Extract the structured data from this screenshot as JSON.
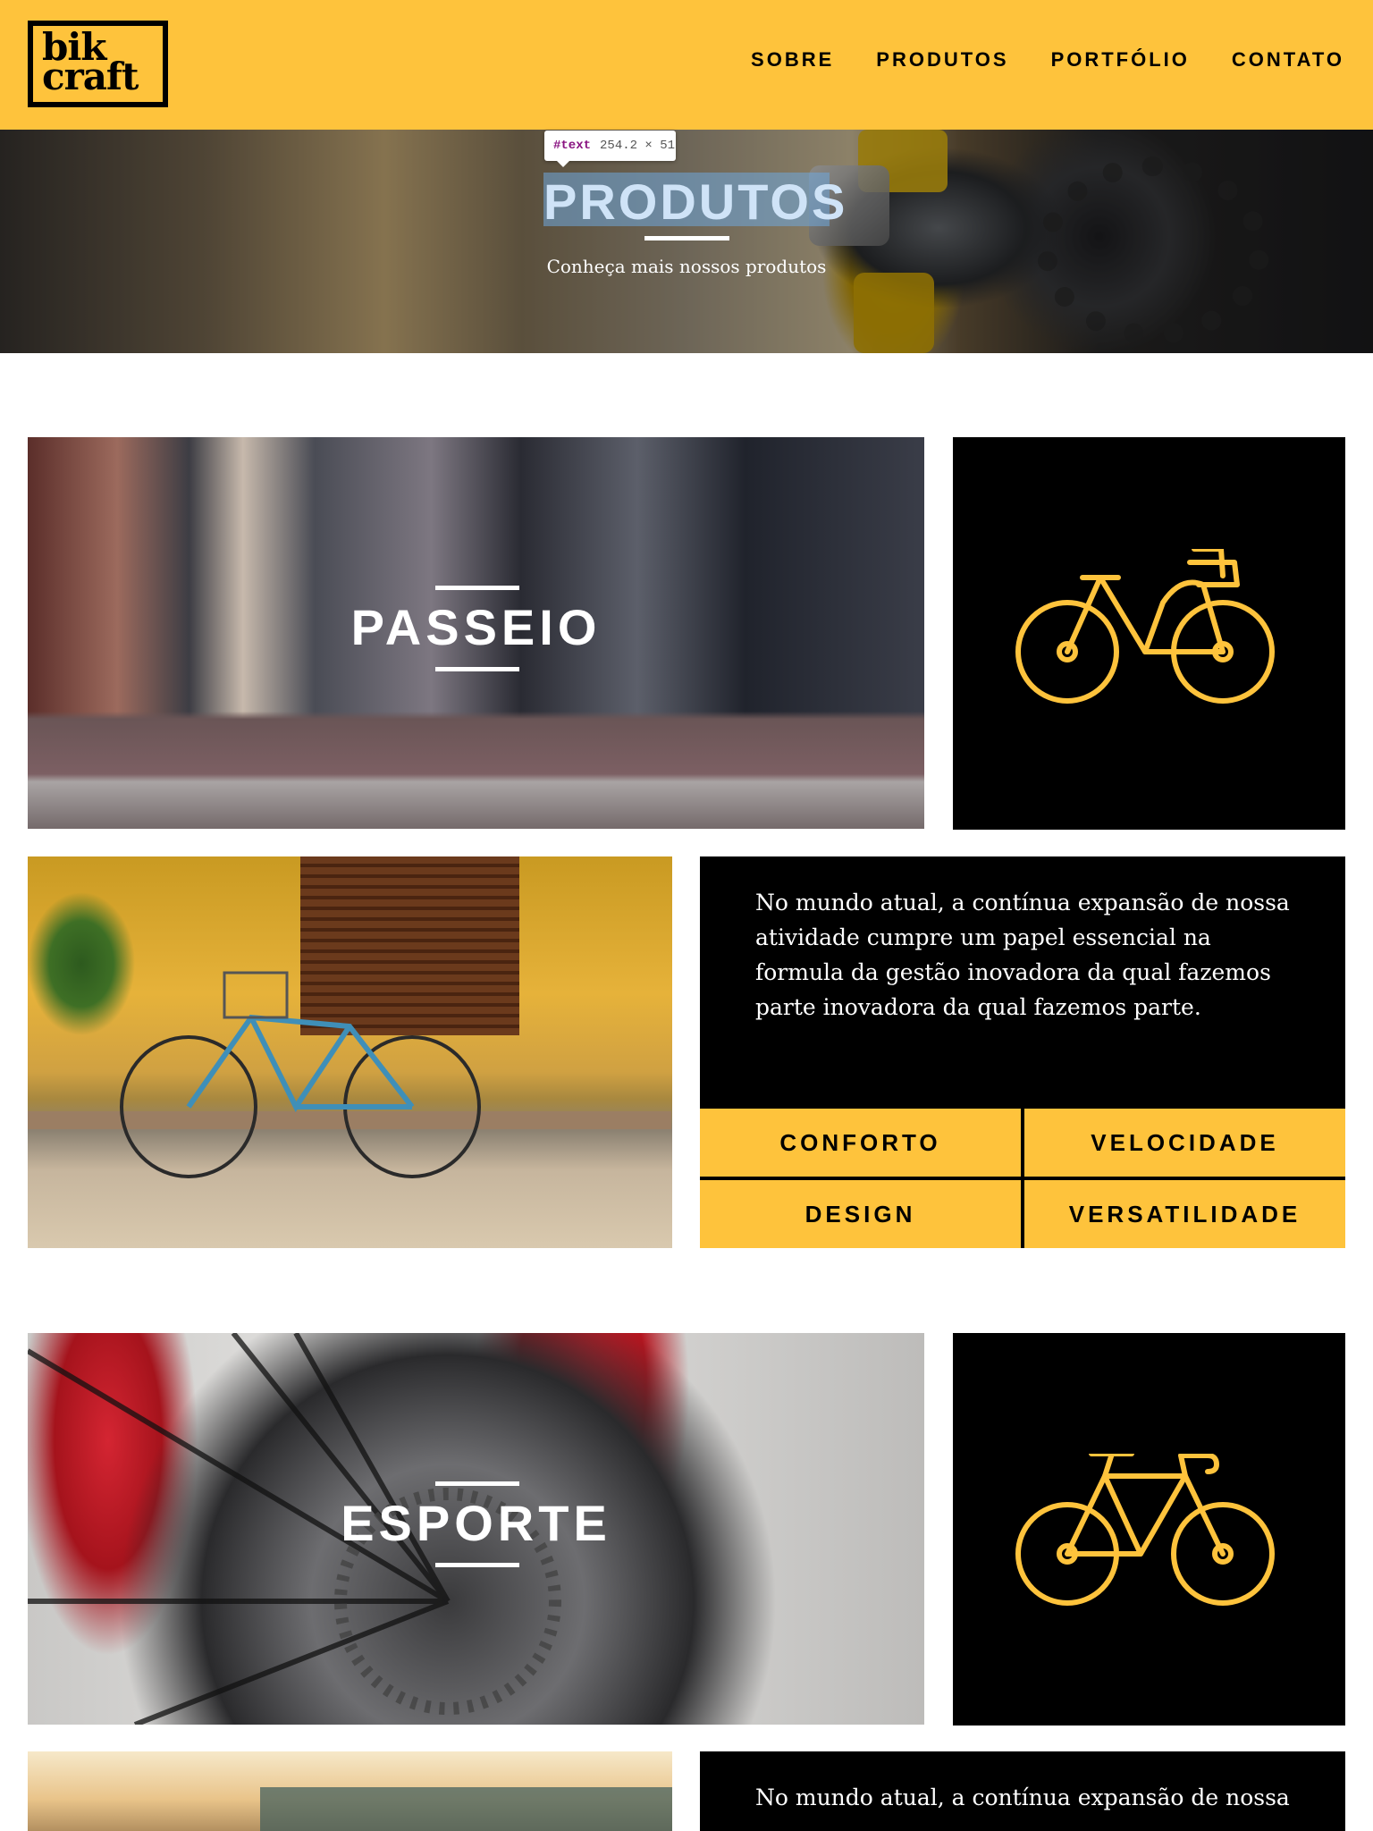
{
  "brand": {
    "logo_line1": "bik",
    "logo_line2": "craft",
    "accent": "#fec33c"
  },
  "nav": {
    "items": [
      "SOBRE",
      "PRODUTOS",
      "PORTFÓLIO",
      "CONTATO"
    ]
  },
  "hero": {
    "title": "PRODUTOS",
    "subtitle": "Conheça mais nossos produtos",
    "devtools_tooltip": {
      "tag": "#text",
      "size": "254.2 × 51"
    }
  },
  "products": [
    {
      "name": "PASSEIO",
      "icon": "city-bike-icon",
      "description": "No mundo atual, a contínua expansão de nossa atividade cumpre um papel essencial na formula da gestão inovadora da qual fazemos parte inovadora da qual fazemos parte.",
      "features": [
        "CONFORTO",
        "VELOCIDADE",
        "DESIGN",
        "VERSATILIDADE"
      ]
    },
    {
      "name": "ESPORTE",
      "icon": "road-bike-icon",
      "description": "No mundo atual, a contínua expansão de nossa"
    }
  ]
}
